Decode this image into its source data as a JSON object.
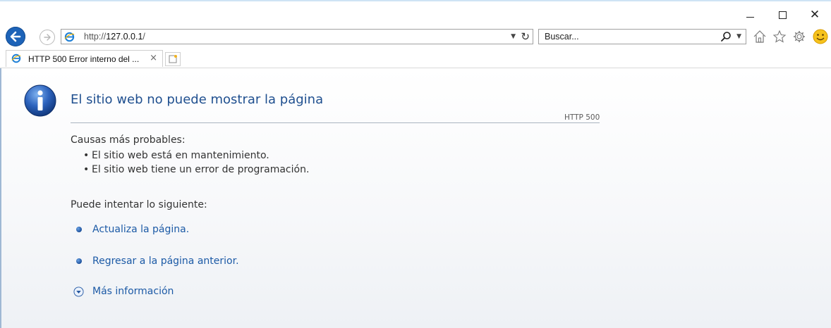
{
  "browser": {
    "address": {
      "protocol": "http://",
      "host": "127.0.0.1",
      "path": "/"
    },
    "search": {
      "placeholder": "Buscar..."
    },
    "tab": {
      "title": "HTTP 500 Error interno del ...",
      "close_glyph": "×"
    }
  },
  "page": {
    "title": "El sitio web no puede mostrar la página",
    "code": "HTTP 500",
    "causes_heading": "Causas más probables:",
    "causes": [
      "El sitio web está en mantenimiento.",
      "El sitio web tiene un error de programación."
    ],
    "try_heading": "Puede intentar lo siguiente:",
    "actions": [
      {
        "label": "Actualiza la página.",
        "icon": "blue-bullet-icon"
      },
      {
        "label": "Regresar a la página anterior.",
        "icon": "blue-bullet-icon"
      },
      {
        "label": "Más información",
        "icon": "expand-arrow-icon"
      }
    ]
  },
  "colors": {
    "title": "#1f4f8f",
    "link": "#1c5aa6",
    "back_button": "#1d63b8"
  }
}
